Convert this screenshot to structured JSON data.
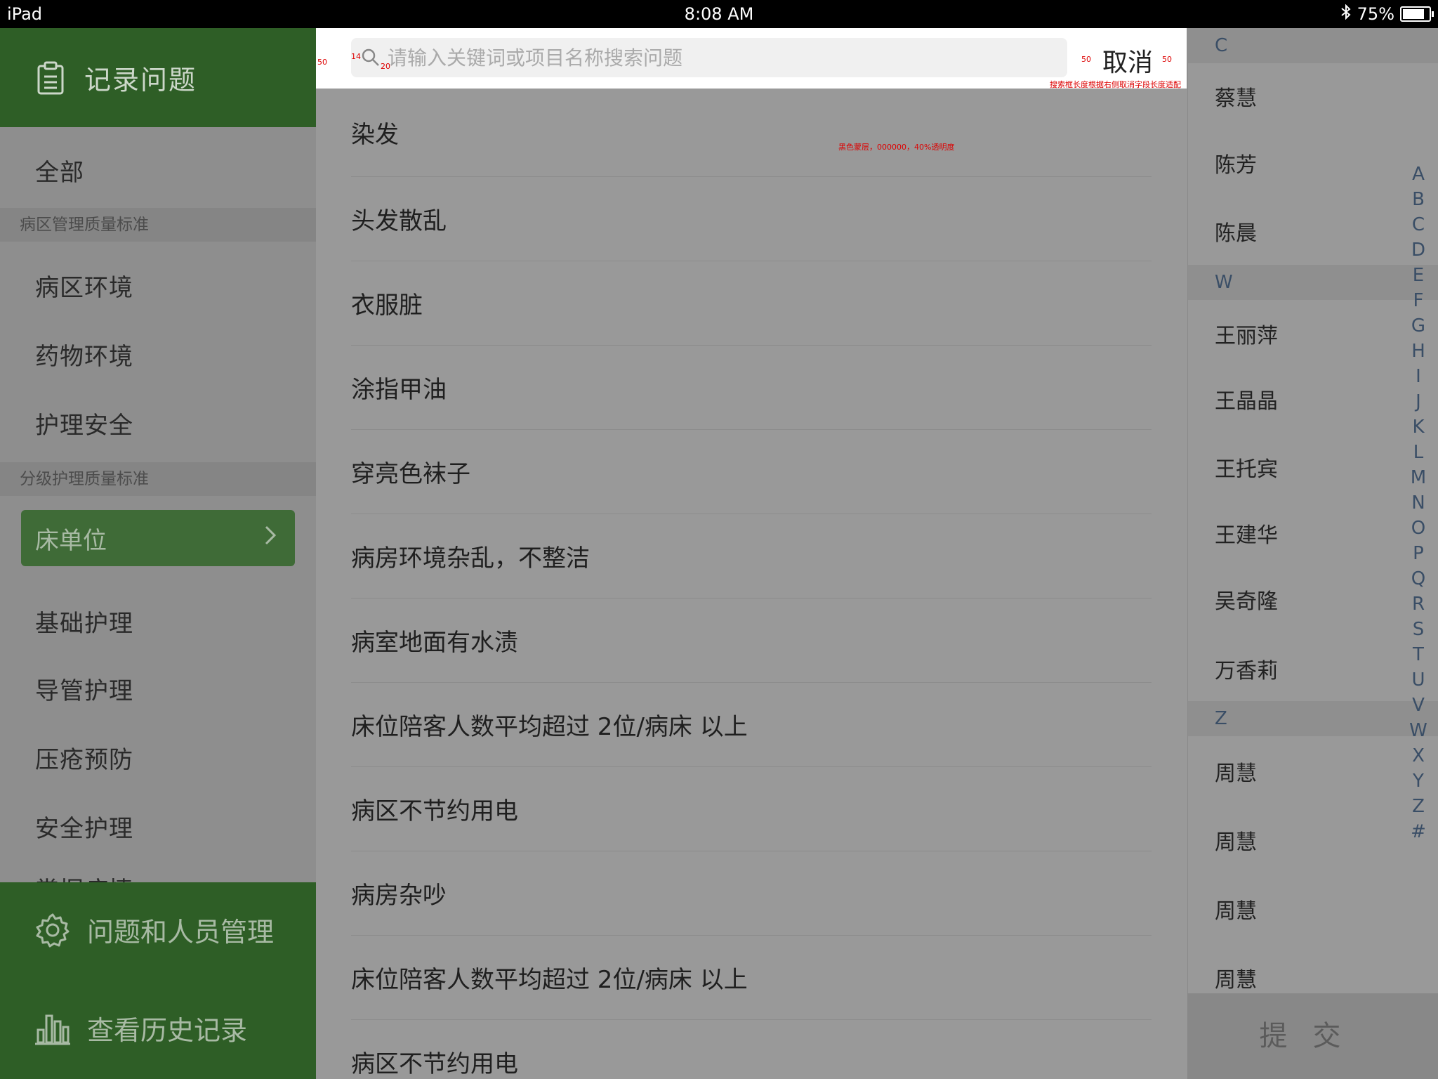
{
  "status_bar": {
    "device": "iPad",
    "time": "8:08 AM",
    "battery": "75%"
  },
  "sidebar": {
    "header": {
      "label": "记录问题",
      "icon": "clipboard-icon"
    },
    "all_label": "全部",
    "section1": "病区管理质量标准",
    "section1_items": [
      "病区环境",
      "药物环境",
      "护理安全"
    ],
    "section2": "分级护理质量标准",
    "active_item": "床单位",
    "section2_items": [
      "基础护理",
      "导管护理",
      "压疮预防",
      "安全护理",
      "掌握病情"
    ],
    "footer": {
      "manage_label": "问题和人员管理",
      "history_label": "查看历史记录"
    }
  },
  "search": {
    "placeholder": "请输入关键词或项目名称搜索问题",
    "cancel_label": "取消"
  },
  "annotations": {
    "a50_left": "50",
    "a14": "14",
    "a20": "20",
    "a50_mid": "50",
    "a50_right": "50",
    "overlay_note": "黑色蒙层，000000，40%透明度",
    "search_note": "搜索框长度根据右侧取消字段长度适配"
  },
  "problems": [
    "染发",
    "头发散乱",
    "衣服脏",
    "涂指甲油",
    "穿亮色袜子",
    "病房环境杂乱，不整洁",
    "病室地面有水渍",
    "床位陪客人数平均超过 2位/病床 以上",
    "病区不节约用电",
    "病房杂吵",
    "床位陪客人数平均超过 2位/病床 以上",
    "病区不节约用电"
  ],
  "people": {
    "sections": [
      {
        "letter": "C",
        "names": [
          "蔡慧",
          "陈芳",
          "陈晨"
        ]
      },
      {
        "letter": "W",
        "names": [
          "王丽萍",
          "王晶晶",
          "王托宾",
          "王建华",
          "吴奇隆",
          "万香莉"
        ]
      },
      {
        "letter": "Z",
        "names": [
          "周慧",
          "周慧",
          "周慧",
          "周慧"
        ]
      }
    ],
    "index": [
      "A",
      "B",
      "C",
      "D",
      "E",
      "F",
      "G",
      "H",
      "I",
      "J",
      "K",
      "L",
      "M",
      "N",
      "O",
      "P",
      "Q",
      "R",
      "S",
      "T",
      "U",
      "V",
      "W",
      "X",
      "Y",
      "Z",
      "#"
    ]
  },
  "submit_label": "提交"
}
